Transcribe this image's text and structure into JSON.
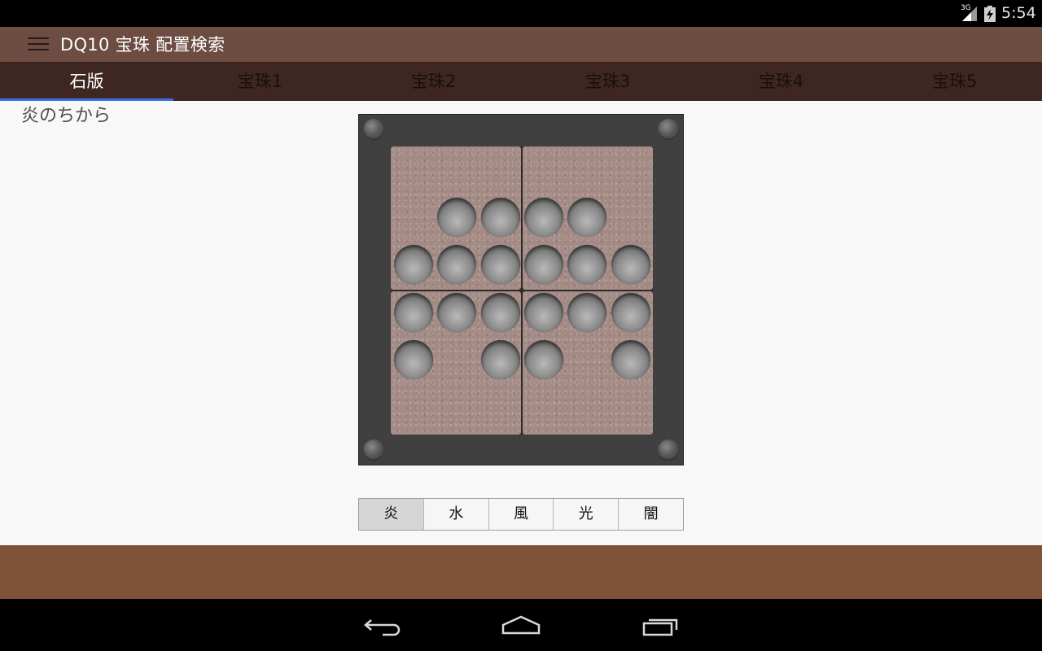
{
  "status_bar": {
    "network": "3G",
    "time": "5:54"
  },
  "action_bar": {
    "menu_icon": "hamburger-icon",
    "title": "DQ10 宝珠 配置検索"
  },
  "tabs": [
    {
      "label": "石版",
      "active": true
    },
    {
      "label": "宝珠1",
      "active": false
    },
    {
      "label": "宝珠2",
      "active": false
    },
    {
      "label": "宝珠3",
      "active": false
    },
    {
      "label": "宝珠4",
      "active": false
    },
    {
      "label": "宝珠5",
      "active": false
    }
  ],
  "content": {
    "subtitle": "炎のちから",
    "board": {
      "rows": 6,
      "cols": 6,
      "filled": [
        [
          0,
          0,
          0,
          0,
          0,
          0
        ],
        [
          0,
          1,
          1,
          1,
          1,
          0
        ],
        [
          1,
          1,
          1,
          1,
          1,
          1
        ],
        [
          1,
          1,
          1,
          1,
          1,
          1
        ],
        [
          1,
          0,
          1,
          1,
          0,
          1
        ],
        [
          0,
          0,
          0,
          0,
          0,
          0
        ]
      ]
    },
    "element_buttons": [
      {
        "label": "炎",
        "selected": true
      },
      {
        "label": "水",
        "selected": false
      },
      {
        "label": "風",
        "selected": false
      },
      {
        "label": "光",
        "selected": false
      },
      {
        "label": "闇",
        "selected": false
      }
    ]
  },
  "colors": {
    "action_bar": "#6d4c41",
    "tab_bar": "#3e2723",
    "tab_indicator": "#3b6ee6",
    "bottom_panel": "#7e533a"
  },
  "nav_bar": {
    "back_icon": "back-icon",
    "home_icon": "home-icon",
    "recents_icon": "recents-icon"
  }
}
